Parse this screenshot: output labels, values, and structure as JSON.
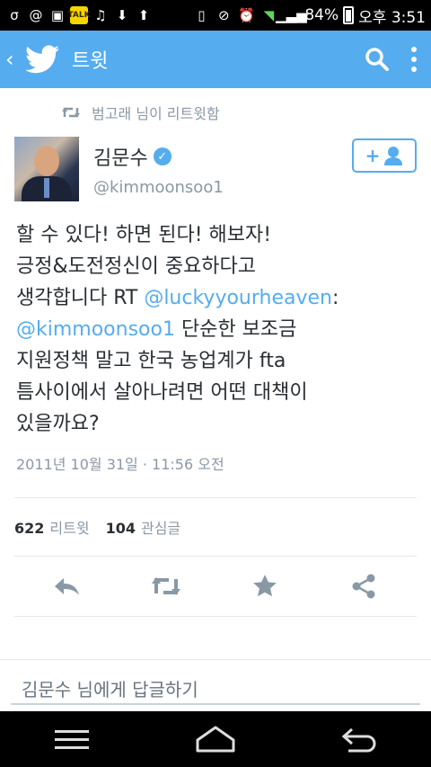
{
  "status_bar": {
    "battery": "84%",
    "time": "오후 3:51",
    "icons": [
      "o-icon",
      "at-icon",
      "image-icon",
      "kakao-talk-icon",
      "music-icon",
      "download-icon",
      "upload-icon",
      "phone-icon",
      "mute-icon",
      "alarm-icon",
      "wifi-icon",
      "signal-icon",
      "battery-icon"
    ]
  },
  "app_bar": {
    "title": "트윗",
    "back_icon": "chevron-left-icon",
    "logo": "twitter-bird-icon",
    "search_icon": "search-icon",
    "menu_icon": "more-vertical-icon"
  },
  "tweet": {
    "retweeted_by": "범고래 님이 리트윗함",
    "author_name": "김문수",
    "author_handle": "@kimmoonsoo1",
    "follow_label": "+",
    "text_parts": [
      {
        "text": "할 수 있다! 하면 된다! 해보자!\n긍정&도전정신이 중요하다고\n생각합니다 RT ",
        "link": false
      },
      {
        "text": "@luckyyourheaven",
        "link": true
      },
      {
        "text": ":\n",
        "link": false
      },
      {
        "text": "@kimmoonsoo1",
        "link": true
      },
      {
        "text": " 단순한 보조금\n지원정책 말고 한국 농업계가 fta\n틈사이에서 살아나려면 어떤 대책이\n있을까요?",
        "link": false
      }
    ],
    "timestamp": "2011년 10월 31일 · 11:56 오전",
    "retweets_count": "622",
    "retweets_label": "리트윗",
    "favorites_count": "104",
    "favorites_label": "관심글"
  },
  "actions": [
    "reply-icon",
    "retweet-icon",
    "favorite-star-icon",
    "share-icon"
  ],
  "reply": {
    "placeholder": "김문수 님에게 답글하기"
  },
  "colors": {
    "accent": "#55acee",
    "text": "#292f33",
    "muted": "#8899a6"
  }
}
